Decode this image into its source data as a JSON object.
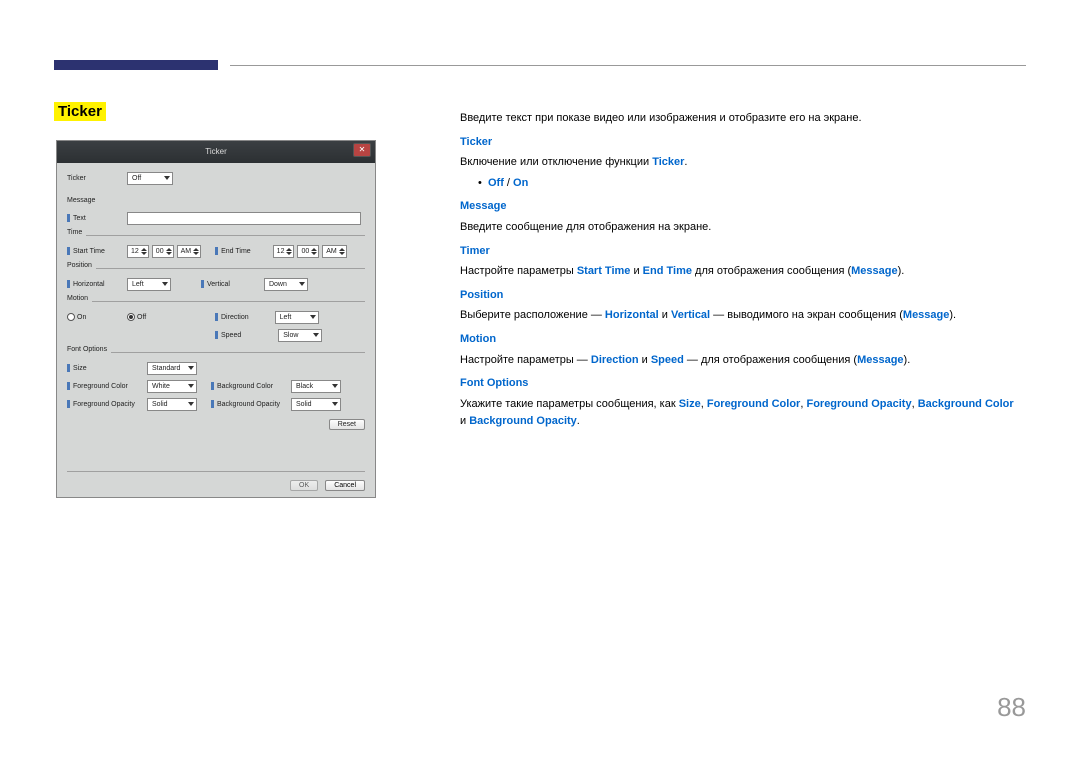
{
  "pageNumber": "88",
  "title": "Ticker",
  "right": {
    "intro": "Введите текст при показе видео или изображения и отобразите его на экране.",
    "ticker": {
      "h": "Ticker",
      "t1": "Включение или отключение функции ",
      "bold": "Ticker",
      "t2": ".",
      "off": "Off",
      "on": "On"
    },
    "message": {
      "h": "Message",
      "p": "Введите сообщение для отображения на экране."
    },
    "timer": {
      "h": "Timer",
      "t1": "Настройте параметры ",
      "b1": "Start Time",
      "t2": " и ",
      "b2": "End Time",
      "t3": " для отображения сообщения (",
      "b3": "Message",
      "t4": ")."
    },
    "position": {
      "h": "Position",
      "t1": "Выберите расположение — ",
      "b1": "Horizontal",
      "t2": " и ",
      "b2": "Vertical",
      "t3": " — выводимого на экран сообщения (",
      "b3": "Message",
      "t4": ")."
    },
    "motion": {
      "h": "Motion",
      "t1": "Настройте параметры — ",
      "b1": "Direction",
      "t2": " и ",
      "b2": "Speed",
      "t3": " — для отображения сообщения (",
      "b3": "Message",
      "t4": ")."
    },
    "font": {
      "h": "Font Options",
      "t1": "Укажите такие параметры сообщения, как ",
      "b1": "Size",
      "b2": "Foreground Color",
      "b3": "Foreground Opacity",
      "b4": "Background Color",
      "t2": " и ",
      "b5": "Background Opacity",
      "t3": "."
    }
  },
  "dlg": {
    "title": "Ticker",
    "labels": {
      "ticker": "Ticker",
      "ticker_val": "Off",
      "message": "Message",
      "text": "Text",
      "time": "Time",
      "startTime": "Start Time",
      "endTime": "End Time",
      "hour1": "12",
      "min1": "00",
      "ampm1": "AM",
      "hour2": "12",
      "min2": "00",
      "ampm2": "AM",
      "position": "Position",
      "horizontal": "Horizontal",
      "h_val": "Left",
      "vertical": "Vertical",
      "v_val": "Down",
      "motion": "Motion",
      "on": "On",
      "off": "Off",
      "direction": "Direction",
      "dir_val": "Left",
      "speed": "Speed",
      "speed_val": "Slow",
      "fontOptions": "Font Options",
      "size": "Size",
      "size_val": "Standard",
      "fgColor": "Foreground Color",
      "fgColor_val": "White",
      "fgOpacity": "Foreground Opacity",
      "fgOpacity_val": "Solid",
      "bgColor": "Background Color",
      "bgColor_val": "Black",
      "bgOpacity": "Background Opacity",
      "bgOpacity_val": "Solid",
      "reset": "Reset",
      "ok": "OK",
      "cancel": "Cancel"
    }
  }
}
